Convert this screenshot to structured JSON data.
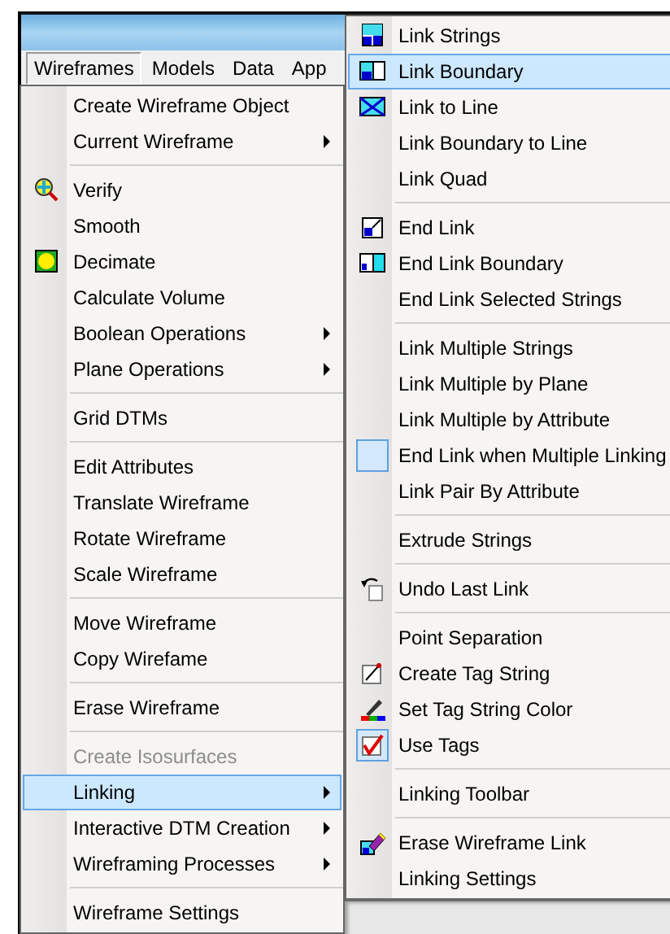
{
  "window": {
    "menu_bar": [
      {
        "label": "Wireframes",
        "selected": true
      },
      {
        "label": "Models",
        "selected": false
      },
      {
        "label": "Data",
        "selected": false
      },
      {
        "label": "App",
        "selected": false
      }
    ]
  },
  "menu": {
    "groups": [
      {
        "items": [
          {
            "label": "Create Wireframe Object",
            "disabled": false,
            "selected": false,
            "submenu": false
          },
          {
            "label": "Current Wireframe",
            "disabled": false,
            "selected": false,
            "submenu": true
          }
        ]
      },
      {
        "items": [
          {
            "label": "Verify",
            "disabled": false,
            "selected": false,
            "submenu": false
          },
          {
            "label": "Smooth",
            "disabled": false,
            "selected": false,
            "submenu": false
          },
          {
            "label": "Decimate",
            "disabled": false,
            "selected": false,
            "submenu": false
          },
          {
            "label": "Calculate Volume",
            "disabled": false,
            "selected": false,
            "submenu": false
          },
          {
            "label": "Boolean Operations",
            "disabled": false,
            "selected": false,
            "submenu": true
          },
          {
            "label": "Plane Operations",
            "disabled": false,
            "selected": false,
            "submenu": true
          }
        ]
      },
      {
        "items": [
          {
            "label": "Grid DTMs",
            "disabled": false,
            "selected": false,
            "submenu": false
          }
        ]
      },
      {
        "items": [
          {
            "label": "Edit Attributes",
            "disabled": false,
            "selected": false,
            "submenu": false
          },
          {
            "label": "Translate Wireframe",
            "disabled": false,
            "selected": false,
            "submenu": false
          },
          {
            "label": "Rotate Wireframe",
            "disabled": false,
            "selected": false,
            "submenu": false
          },
          {
            "label": "Scale Wireframe",
            "disabled": false,
            "selected": false,
            "submenu": false
          }
        ]
      },
      {
        "items": [
          {
            "label": "Move Wireframe",
            "disabled": false,
            "selected": false,
            "submenu": false
          },
          {
            "label": "Copy Wirefame",
            "disabled": false,
            "selected": false,
            "submenu": false
          }
        ]
      },
      {
        "items": [
          {
            "label": "Erase Wireframe",
            "disabled": false,
            "selected": false,
            "submenu": false
          }
        ]
      },
      {
        "items": [
          {
            "label": "Create Isosurfaces",
            "disabled": true,
            "selected": false,
            "submenu": false
          },
          {
            "label": "Linking",
            "disabled": false,
            "selected": true,
            "submenu": true
          },
          {
            "label": "Interactive DTM Creation",
            "disabled": false,
            "selected": false,
            "submenu": true
          },
          {
            "label": "Wireframing Processes",
            "disabled": false,
            "selected": false,
            "submenu": true
          }
        ]
      },
      {
        "items": [
          {
            "label": "Wireframe Settings",
            "disabled": false,
            "selected": false,
            "submenu": false
          }
        ]
      }
    ]
  },
  "submenu": {
    "groups": [
      {
        "items": [
          {
            "label": "Link Strings",
            "selected": false,
            "checked": false
          },
          {
            "label": "Link Boundary",
            "selected": true,
            "checked": false
          },
          {
            "label": "Link to Line",
            "selected": false,
            "checked": false
          },
          {
            "label": "Link Boundary to Line",
            "selected": false,
            "checked": false
          },
          {
            "label": "Link Quad",
            "selected": false,
            "checked": false
          }
        ]
      },
      {
        "items": [
          {
            "label": "End Link",
            "selected": false,
            "checked": false
          },
          {
            "label": "End Link Boundary",
            "selected": false,
            "checked": false
          },
          {
            "label": "End Link Selected Strings",
            "selected": false,
            "checked": false
          }
        ]
      },
      {
        "items": [
          {
            "label": "Link Multiple Strings",
            "selected": false,
            "checked": false
          },
          {
            "label": "Link Multiple by Plane",
            "selected": false,
            "checked": false
          },
          {
            "label": "Link Multiple by Attribute",
            "selected": false,
            "checked": false
          },
          {
            "label": "End Link when Multiple Linking",
            "selected": false,
            "checked": true
          },
          {
            "label": "Link Pair By Attribute",
            "selected": false,
            "checked": false
          }
        ]
      },
      {
        "items": [
          {
            "label": "Extrude Strings",
            "selected": false,
            "checked": false
          }
        ]
      },
      {
        "items": [
          {
            "label": "Undo Last Link",
            "selected": false,
            "checked": false
          }
        ]
      },
      {
        "items": [
          {
            "label": "Point Separation",
            "selected": false,
            "checked": false
          },
          {
            "label": "Create Tag String",
            "selected": false,
            "checked": false
          },
          {
            "label": "Set Tag String Color",
            "selected": false,
            "checked": false
          },
          {
            "label": "Use Tags",
            "selected": false,
            "checked": true
          }
        ]
      },
      {
        "items": [
          {
            "label": "Linking Toolbar",
            "selected": false,
            "checked": false
          }
        ]
      },
      {
        "items": [
          {
            "label": "Erase Wireframe Link",
            "selected": false,
            "checked": false
          },
          {
            "label": "Linking Settings",
            "selected": false,
            "checked": false
          }
        ]
      }
    ]
  }
}
